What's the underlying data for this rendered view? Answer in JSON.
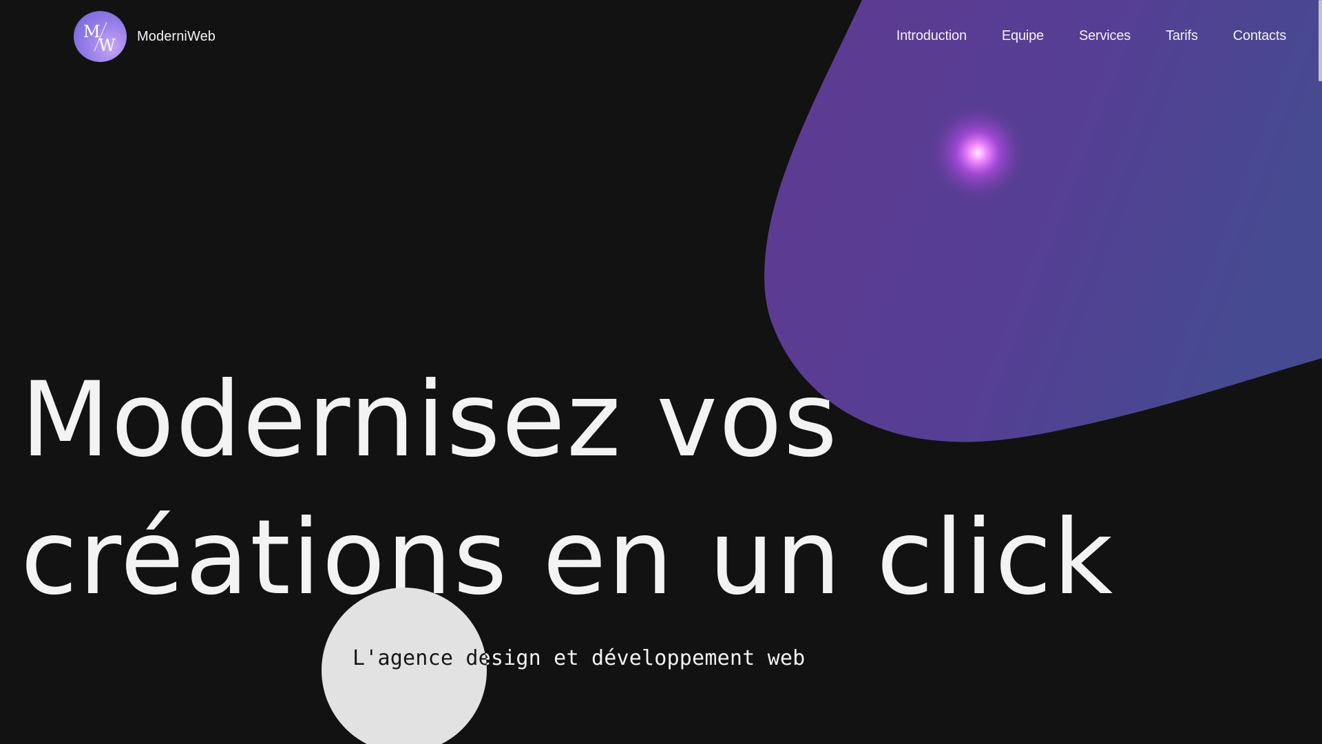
{
  "brand": {
    "logo_letters": "MW",
    "name": "ModerniWeb"
  },
  "nav": {
    "items": [
      "Introduction",
      "Equipe",
      "Services",
      "Tarifs",
      "Contacts"
    ]
  },
  "hero": {
    "title_line1": "Modernisez vos",
    "title_line2": "créations en un click",
    "subtitle": "L'agence design et développement web"
  },
  "colors": {
    "background": "#121212",
    "blob": "#5e3a91",
    "glow": "#f0a0ff",
    "text": "#f2f2f2",
    "cursor_circle": "#e2e2e2"
  }
}
